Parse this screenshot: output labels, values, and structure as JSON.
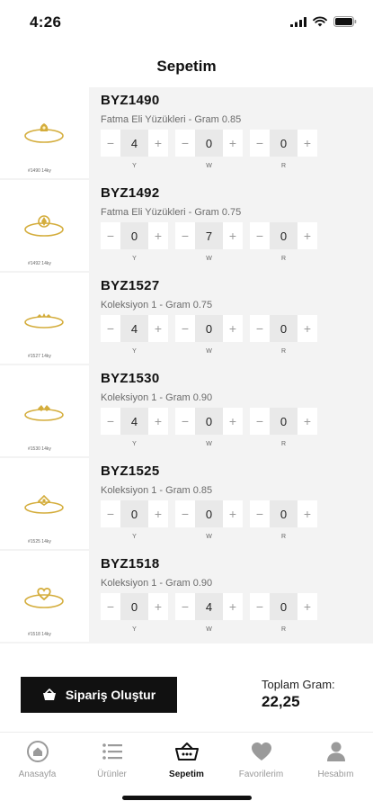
{
  "status_bar": {
    "time": "4:26"
  },
  "header": {
    "title": "Sepetim"
  },
  "stepper_labels": [
    "Y",
    "W",
    "R"
  ],
  "cart_items": [
    {
      "code": "BYZ1490",
      "description": "Fatma Eli Yüzükleri - Gram 0.85",
      "y": "4",
      "w": "0",
      "r": "0",
      "thumb_caption": "#1490 14ky"
    },
    {
      "code": "BYZ1492",
      "description": "Fatma Eli Yüzükleri - Gram 0.75",
      "y": "0",
      "w": "7",
      "r": "0",
      "thumb_caption": "#1492 14ky"
    },
    {
      "code": "BYZ1527",
      "description": "Koleksiyon 1 - Gram 0.75",
      "y": "4",
      "w": "0",
      "r": "0",
      "thumb_caption": "#1527 14ky"
    },
    {
      "code": "BYZ1530",
      "description": "Koleksiyon 1 - Gram 0.90",
      "y": "4",
      "w": "0",
      "r": "0",
      "thumb_caption": "#1530 14ky"
    },
    {
      "code": "BYZ1525",
      "description": "Koleksiyon 1 - Gram 0.85",
      "y": "0",
      "w": "0",
      "r": "0",
      "thumb_caption": "#1525 14ky"
    },
    {
      "code": "BYZ1518",
      "description": "Koleksiyon 1 - Gram 0.90",
      "y": "0",
      "w": "4",
      "r": "0",
      "thumb_caption": "#1518 14ky"
    }
  ],
  "footer": {
    "order_button_label": "Sipariş Oluştur",
    "total_label": "Toplam Gram:",
    "total_value": "22,25"
  },
  "tabs": [
    {
      "label": "Anasayfa",
      "icon": "home-icon",
      "active": false
    },
    {
      "label": "Ürünler",
      "icon": "list-icon",
      "active": false
    },
    {
      "label": "Sepetim",
      "icon": "basket-icon",
      "active": true
    },
    {
      "label": "Favorilerim",
      "icon": "heart-icon",
      "active": false
    },
    {
      "label": "Hesabım",
      "icon": "user-icon",
      "active": false
    }
  ],
  "colors": {
    "accent": "#111111",
    "inactive": "#9a9a9a",
    "list_background": "#f3f3f3",
    "gold": "#d4ad3c"
  }
}
